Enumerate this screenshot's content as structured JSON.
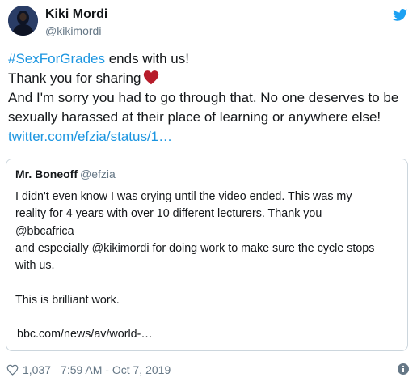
{
  "author": {
    "name": "Kiki Mordi",
    "handle": "@kikimordi"
  },
  "tweet": {
    "hashtag": "#SexForGrades",
    "line1_rest": " ends with us!",
    "line2": "Thank you for sharing",
    "line3": "And I'm sorry you had to go through that. No one deserves to be",
    "line4": "sexually harassed at their place of learning or anywhere else!",
    "link": "twitter.com/efzia/status/1…"
  },
  "quote": {
    "name": "Mr. Boneoff",
    "handle": "@efzia",
    "lines": [
      "I didn't even know I was crying until the video ended. This was my",
      "reality for 4 years with over 10 different lecturers. Thank you",
      "@bbcafrica",
      "and especially @kikimordi for doing work to make sure the cycle stops",
      "with us.",
      "",
      "This is brilliant work.",
      "",
      "bbc.com/news/av/world-…"
    ]
  },
  "footer": {
    "likes": "1,037",
    "timestamp": "7:59 AM - Oct 7, 2019"
  },
  "colors": {
    "link": "#1b95e0",
    "secondary": "#657786",
    "heart": "#b71c2a",
    "twitter_blue": "#1da1f2"
  },
  "icons": [
    "avatar",
    "twitter-bird-icon",
    "heart-emoji-icon",
    "like-heart-icon",
    "info-icon"
  ]
}
